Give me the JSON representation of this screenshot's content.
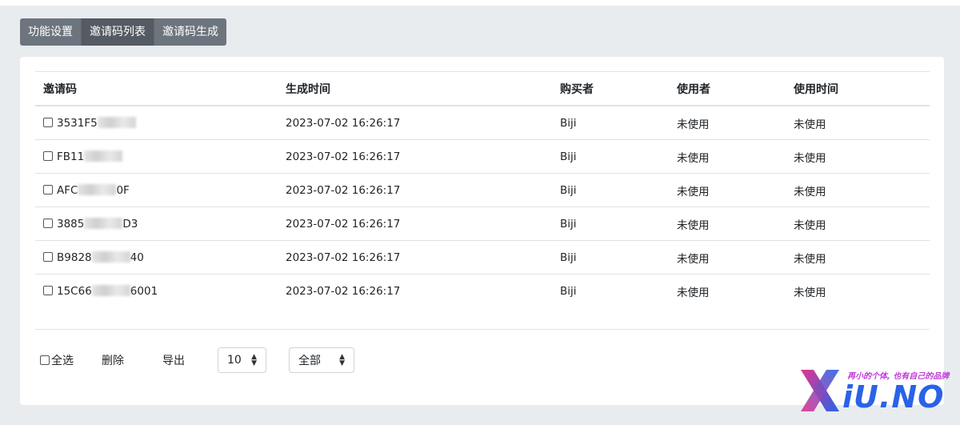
{
  "tabs": [
    {
      "label": "功能设置",
      "active": false
    },
    {
      "label": "邀请码列表",
      "active": true
    },
    {
      "label": "邀请码生成",
      "active": false
    }
  ],
  "table": {
    "headers": [
      "邀请码",
      "生成时间",
      "购买者",
      "使用者",
      "使用时间"
    ],
    "rows": [
      {
        "code_start": "3531F5",
        "code_end": "",
        "time": "2023-07-02 16:26:17",
        "buyer": "Biji",
        "user": "未使用",
        "used_time": "未使用"
      },
      {
        "code_start": "FB11",
        "code_end": "",
        "time": "2023-07-02 16:26:17",
        "buyer": "Biji",
        "user": "未使用",
        "used_time": "未使用"
      },
      {
        "code_start": "AFC",
        "code_end": "0F",
        "time": "2023-07-02 16:26:17",
        "buyer": "Biji",
        "user": "未使用",
        "used_time": "未使用"
      },
      {
        "code_start": "3885",
        "code_end": "D3",
        "time": "2023-07-02 16:26:17",
        "buyer": "Biji",
        "user": "未使用",
        "used_time": "未使用"
      },
      {
        "code_start": "B9828",
        "code_end": "40",
        "time": "2023-07-02 16:26:17",
        "buyer": "Biji",
        "user": "未使用",
        "used_time": "未使用"
      },
      {
        "code_start": "15C66",
        "code_end": "6001",
        "time": "2023-07-02 16:26:17",
        "buyer": "Biji",
        "user": "未使用",
        "used_time": "未使用"
      }
    ]
  },
  "footer": {
    "select_all": "全选",
    "delete": "删除",
    "export": "导出",
    "page_size": "10",
    "filter": "全部"
  },
  "watermark": {
    "slogan": "再小的个体, 也有自己的品牌",
    "word": "iU.NO",
    "colors": {
      "pink": "#e0358f",
      "blue": "#2a62e8",
      "purple": "#c03ad8"
    }
  }
}
